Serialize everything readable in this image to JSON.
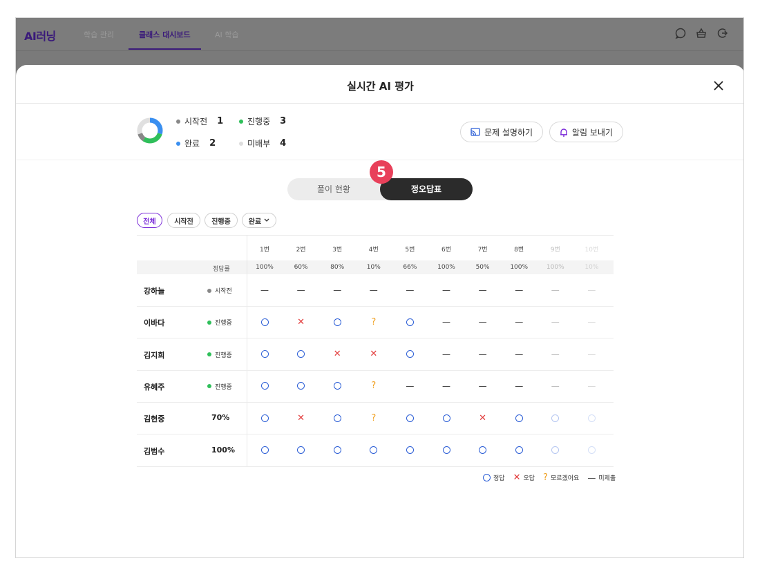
{
  "app": {
    "logo": "AI러닝",
    "nav": [
      {
        "label": "학습 관리",
        "active": false
      },
      {
        "label": "클래스 대시보드",
        "active": true
      },
      {
        "label": "AI 학습",
        "active": false
      }
    ],
    "icons": [
      "chat-icon",
      "basket-icon",
      "logout-icon"
    ]
  },
  "modal": {
    "title": "실시간 AI 평가",
    "stats": {
      "not_started_label": "시작전",
      "not_started": "1",
      "in_progress_label": "진행중",
      "in_progress": "3",
      "done_label": "완료",
      "done": "2",
      "not_joined_label": "미배부",
      "not_joined": "4"
    },
    "explain_button": "문제 설명하기",
    "alert_button": "알림 보내기",
    "tabs": [
      "풀이 현황",
      "정오답표"
    ],
    "active_tab": "정오답표",
    "step_badge": "5",
    "filters": [
      "전체",
      "시작전",
      "진행중",
      "완료"
    ],
    "active_filter": "전체",
    "rate_label": "정답률",
    "questions": [
      "1번",
      "2번",
      "3번",
      "4번",
      "5번",
      "6번",
      "7번",
      "8번",
      "9번",
      "10번"
    ],
    "rates": [
      "100%",
      "60%",
      "80%",
      "10%",
      "66%",
      "100%",
      "50%",
      "100%",
      "100%",
      "10%"
    ],
    "students": [
      {
        "name": "강하늘",
        "status": "시작전",
        "status_color": "#888888",
        "score": "",
        "marks": [
          "-",
          "-",
          "-",
          "-",
          "-",
          "-",
          "-",
          "-",
          "-",
          "-"
        ]
      },
      {
        "name": "이바다",
        "status": "진행중",
        "status_color": "#2fbf5a",
        "score": "",
        "marks": [
          "o",
          "x",
          "o",
          "?",
          "o",
          "-",
          "-",
          "-",
          "-",
          "-"
        ]
      },
      {
        "name": "김지희",
        "status": "진행중",
        "status_color": "#2fbf5a",
        "score": "",
        "marks": [
          "o",
          "o",
          "x",
          "x",
          "o",
          "-",
          "-",
          "-",
          "-",
          "-"
        ]
      },
      {
        "name": "유혜주",
        "status": "진행중",
        "status_color": "#2fbf5a",
        "score": "",
        "marks": [
          "o",
          "o",
          "o",
          "?",
          "-",
          "-",
          "-",
          "-",
          "-",
          "-"
        ]
      },
      {
        "name": "김현중",
        "status": "",
        "status_color": "",
        "score": "70%",
        "marks": [
          "o",
          "x",
          "o",
          "?",
          "o",
          "o",
          "x",
          "o",
          "o",
          "o"
        ]
      },
      {
        "name": "김범수",
        "status": "",
        "status_color": "",
        "score": "100%",
        "marks": [
          "o",
          "o",
          "o",
          "o",
          "o",
          "o",
          "o",
          "o",
          "o",
          "o"
        ]
      }
    ],
    "legend": {
      "correct": "정답",
      "wrong": "오답",
      "unknown": "모르겠어요",
      "unsubmitted": "미제출"
    },
    "colors": {
      "accent": "#7a2ad8",
      "badge": "#e8405a",
      "correct": "#2a5dd6",
      "wrong": "#e23a3a",
      "unknown": "#f0a020",
      "in_progress": "#2fbf5a",
      "done": "#3a8ff0",
      "not_started": "#888888",
      "not_joined": "#cccccc"
    }
  }
}
